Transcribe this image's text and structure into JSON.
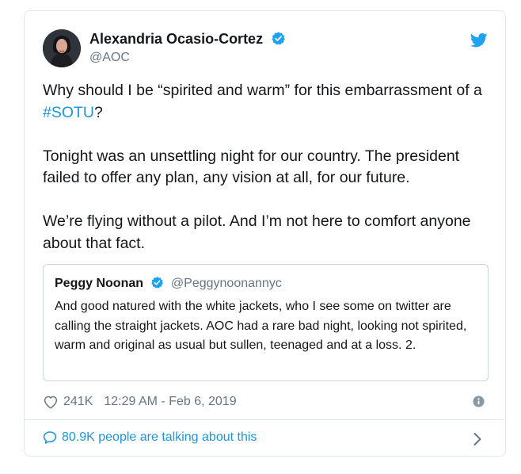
{
  "author": {
    "name": "Alexandria Ocasio-Cortez",
    "handle": "@AOC",
    "avatar_icon": "profile-photo"
  },
  "tweet": {
    "line1_before": "Why should I be “spirited and warm” for this embarrassment of a",
    "hashtag": "#SOTU",
    "line1_after": "?",
    "paragraph2": "Tonight was an unsettling night for our country. The president failed to offer any plan, any vision at all, for our future.",
    "paragraph3": "We’re flying without a pilot. And I’m not here to comfort anyone about that fact."
  },
  "quoted_tweet": {
    "name": "Peggy Noonan",
    "handle": "@Peggynoonannyc",
    "text": "And good natured with the white jackets, who I see some on twitter are calling the straight jackets. AOC had a rare bad night, looking not spirited, warm and original as usual but sullen, teenaged and at a loss. 2."
  },
  "meta": {
    "likes": "241K",
    "timestamp": "12:29 AM - Feb 6, 2019"
  },
  "footer": {
    "talking_label": "80.9K people are talking about this"
  },
  "colors": {
    "accent": "#1b95e0",
    "verified": "#1da1f2",
    "secondary_text": "#657786",
    "border": "#e1e8ed"
  }
}
